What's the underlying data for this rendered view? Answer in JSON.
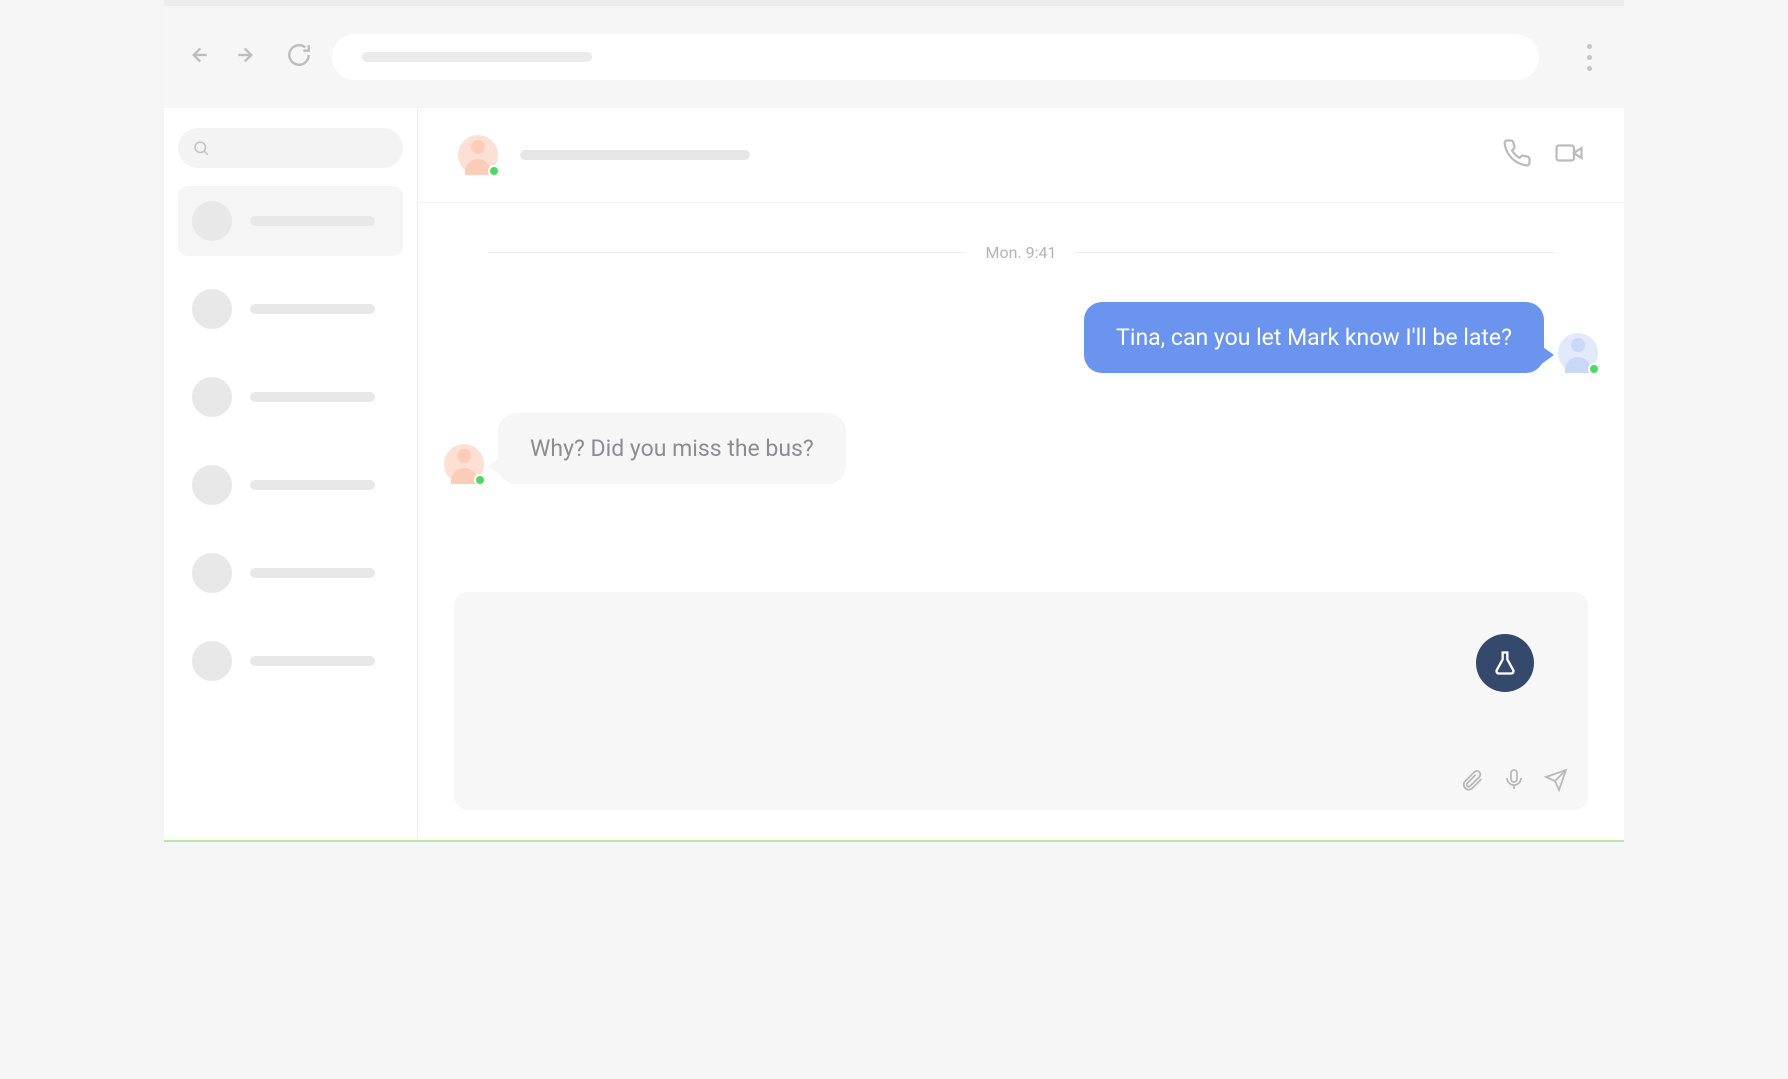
{
  "browser": {
    "url_placeholder": ""
  },
  "chat": {
    "timestamp": "Mon. 9:41",
    "messages": {
      "m0": "Tina, can you let Mark know I'll be late?",
      "m1": "Why? Did you miss the bus?"
    },
    "colors": {
      "sent_bubble": "#6b94ef",
      "received_bubble": "#f6f6f7",
      "online": "#4cd964",
      "fab": "#34496b"
    }
  },
  "composer": {
    "placeholder": ""
  }
}
